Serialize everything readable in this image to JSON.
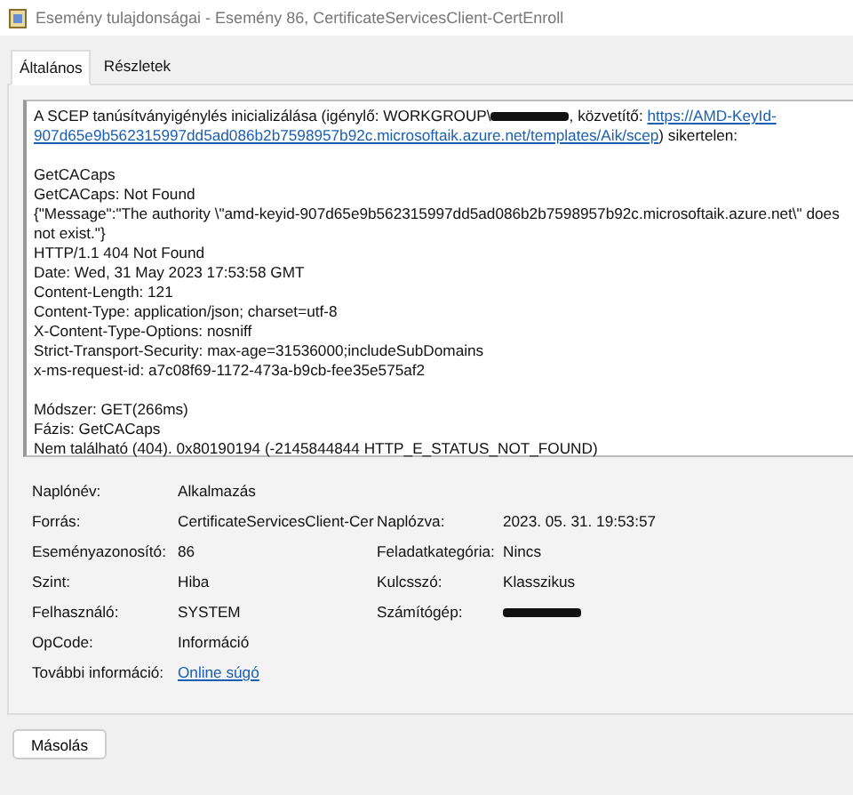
{
  "window": {
    "title": "Esemény tulajdonságai - Esemény 86, CertificateServicesClient-CertEnroll"
  },
  "tabs": [
    {
      "label": "Általános",
      "selected": true
    },
    {
      "label": "Részletek",
      "selected": false
    }
  ],
  "message": {
    "intro_before": "A SCEP tanúsítványigénylés inicializálása (igénylő: WORKGROUP\\",
    "intro_middle": ", közvetítő: ",
    "link_parts": [
      "https://AMD-KeyId-",
      "907d65e9b562315997dd5ad086b2b7598957b92c.microsoftaik.azure.net/templates/Aik/scep"
    ],
    "intro_after": ") sikertelen:",
    "blocks": [
      [
        "GetCACaps",
        "GetCACaps: Not Found",
        "{\"Message\":\"The authority \\\"amd-keyid-907d65e9b562315997dd5ad086b2b7598957b92c.microsoftaik.azure.net\\\" does not exist.\"}",
        "HTTP/1.1 404 Not Found",
        "Date: Wed, 31 May 2023 17:53:58 GMT",
        "Content-Length: 121",
        "Content-Type: application/json; charset=utf-8",
        "X-Content-Type-Options: nosniff",
        "Strict-Transport-Security: max-age=31536000;includeSubDomains",
        "x-ms-request-id: a7c08f69-1172-473a-b9cb-fee35e575af2"
      ],
      [
        "Módszer: GET(266ms)",
        "Fázis: GetCACaps",
        "Nem található (404). 0x80190194 (-2145844844 HTTP_E_STATUS_NOT_FOUND)"
      ]
    ]
  },
  "properties": [
    {
      "label": "Naplónév:",
      "value": "Alkalmazás",
      "kind": "text"
    },
    {
      "label": "Forrás:",
      "value": "CertificateServicesClient-Cer",
      "kind": "text",
      "right": {
        "label": "Naplózva:",
        "value": "2023. 05. 31. 19:53:57",
        "kind": "text"
      }
    },
    {
      "label": "Eseményazonosító:",
      "value": "86",
      "kind": "text",
      "right": {
        "label": "Feladatkategória:",
        "value": "Nincs",
        "kind": "text"
      }
    },
    {
      "label": "Szint:",
      "value": "Hiba",
      "kind": "text",
      "right": {
        "label": "Kulcsszó:",
        "value": "Klasszikus",
        "kind": "text"
      }
    },
    {
      "label": "Felhasználó:",
      "value": "SYSTEM",
      "kind": "text",
      "right": {
        "label": "Számítógép:",
        "kind": "redacted"
      }
    },
    {
      "label": "OpCode:",
      "value": "Információ",
      "kind": "text"
    },
    {
      "label": "További információ:",
      "value": "Online súgó",
      "kind": "link"
    }
  ],
  "buttons": [
    "Másolás"
  ]
}
